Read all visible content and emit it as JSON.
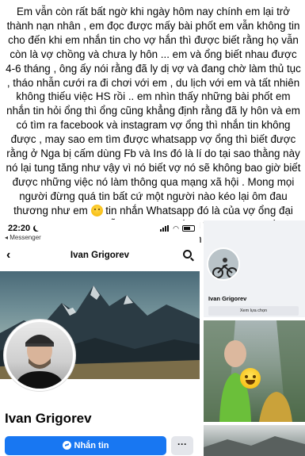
{
  "post": {
    "paragraph": "Em vẫn còn rất bất ngờ khi ngày hôm nay chính em lại trở thành nạn nhân , em đọc được mấy bài phốt em vẫn không tin cho đến khi em nhắn tin cho vợ hắn thì được biết rằng họ vẫn còn là vợ chồng và chưa ly hôn ... em và ổng biết nhau được 4-6 tháng , ông ấy nói rằng đã ly dị vợ và đang chờ làm thủ tục , tháo nhẫn cưới ra đi chơi với em , du lịch với em và tất nhiên không thiếu việc HS rồi .. em nhìn thấy những bài phốt em nhắn tin hỏi ổng thì ổng cũng khẳng định rằng đã ly hôn và em có tìm ra facebook và instagram vợ ổng thì nhắn tin không được , may sao em tìm được whatsapp vợ ổng thì biết được rằng ở Nga bị cấm dùng Fb và Ins đó là lí do tại sao thằng này nó lại tung tăng như vậy vì nó biết vợ nó sẽ không bao giờ biết được những việc nó làm thông qua mạng xã hội . Mong mọi người đừng quá tin bất cứ một người nào kéo lại ôm đau thương như em",
    "paragraph_end": " tin nhắn Whatsapp đó là của vợ ổng đại khái nội dung là họ vẫn còn là vợ chồng và không có bất cứ chuyện ly hôn nào diễn ra",
    "emoji": "sad-face-emoji"
  },
  "phone": {
    "status_time": "22:20",
    "back_app": "◂ Messenger",
    "nav_title": "Ivan Grigorev",
    "back_icon": "‹",
    "profile_name": "Ivan Grigorev",
    "message_button": "Nhắn tin",
    "more_button": "···"
  },
  "right_card": {
    "name": "Ivan Grigorev",
    "button": "Xem lựa chọn"
  },
  "colors": {
    "facebook_blue": "#1877f2",
    "button_grey": "#e4e6eb"
  }
}
